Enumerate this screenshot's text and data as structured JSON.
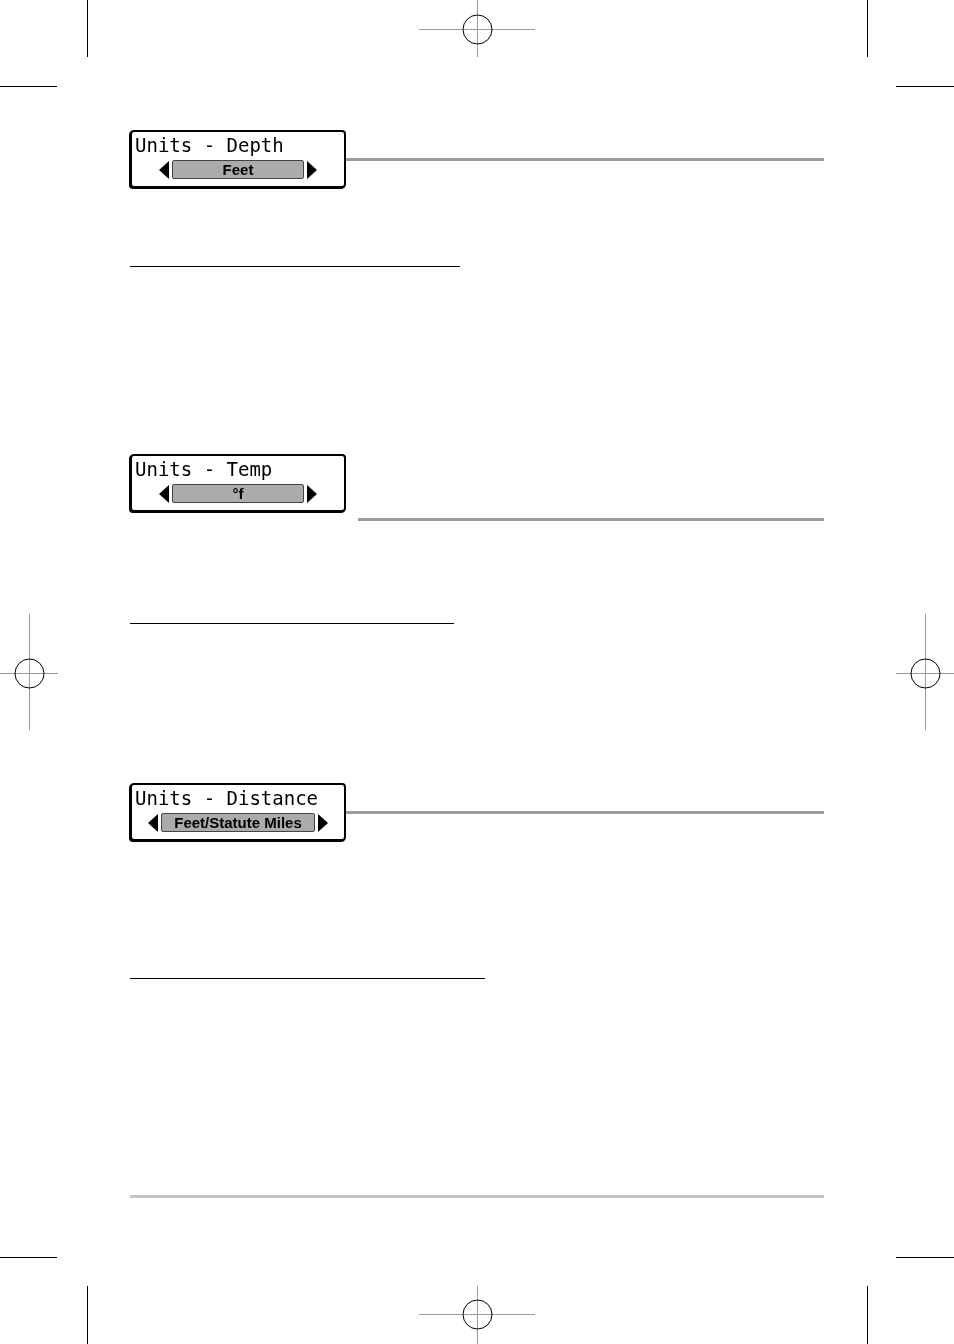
{
  "menus": [
    {
      "title": "Units - Depth",
      "value": "Feet"
    },
    {
      "title": "Units - Temp",
      "value": "°f"
    },
    {
      "title": "Units - Distance",
      "value": "Feet/Statute Miles"
    }
  ]
}
